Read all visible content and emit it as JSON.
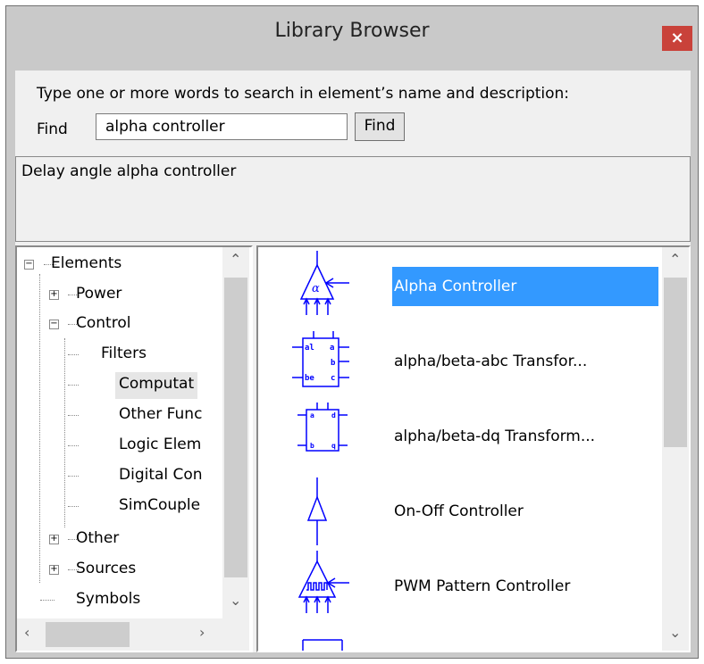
{
  "window": {
    "title": "Library Browser",
    "close_glyph": "×"
  },
  "search": {
    "instruction": "Type one or more words to search in element’s name and  description:",
    "find_label": "Find",
    "value": "alpha controller",
    "button_label": "Find"
  },
  "description": "Delay angle alpha controller",
  "tree": {
    "items": [
      {
        "label": "Elements",
        "expander": "−",
        "level": 0
      },
      {
        "label": "Power",
        "expander": "+",
        "level": 1
      },
      {
        "label": "Control",
        "expander": "−",
        "level": 1
      },
      {
        "label": "Filters",
        "level": 2
      },
      {
        "label": "Computat",
        "level": 2,
        "selected": true
      },
      {
        "label": "Other Func",
        "level": 2
      },
      {
        "label": "Logic Elem",
        "level": 2
      },
      {
        "label": "Digital Con",
        "level": 2
      },
      {
        "label": "SimCouple",
        "level": 2
      },
      {
        "label": "Other",
        "expander": "+",
        "level": 1
      },
      {
        "label": "Sources",
        "expander": "+",
        "level": 1
      },
      {
        "label": "Symbols",
        "level": 1
      }
    ]
  },
  "list": {
    "items": [
      {
        "label": "Alpha Controller",
        "icon": "alpha-controller-icon",
        "selected": true
      },
      {
        "label": "alpha/beta-abc Transfor...",
        "icon": "abc-transform-icon"
      },
      {
        "label": "alpha/beta-dq Transform...",
        "icon": "dq-transform-icon"
      },
      {
        "label": "On-Off Controller",
        "icon": "on-off-controller-icon"
      },
      {
        "label": "PWM Pattern Controller",
        "icon": "pwm-controller-icon"
      }
    ]
  },
  "colors": {
    "selection": "#3399ff",
    "close_button": "#c9423a",
    "symbol_blue": "#0000ff"
  }
}
